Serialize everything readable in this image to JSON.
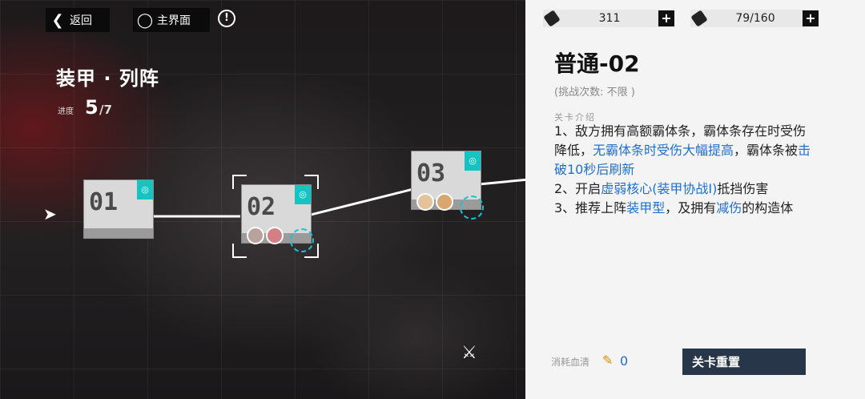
{
  "nav": {
    "back_label": "返回",
    "home_label": "主界面"
  },
  "chapter": {
    "title": "装甲 · 列阵",
    "progress_label": "进度",
    "progress_current": "5",
    "progress_total": "/7"
  },
  "stages": [
    {
      "number": "01"
    },
    {
      "number": "02"
    },
    {
      "number": "03"
    }
  ],
  "resources": [
    {
      "icon": "ticket-icon",
      "value": "311"
    },
    {
      "icon": "serum-icon",
      "value": "79/160"
    }
  ],
  "detail": {
    "title": "普通-02",
    "attempts": "(挑战次数: 不限 )",
    "desc_title": "关卡介绍",
    "line1_a": "1、敌方拥有高额霸体条，霸体条存在时受伤降低，",
    "line1_hl1": "无霸体条时受伤大幅提高",
    "line1_b": "，霸体条被",
    "line1_hl2": "击破10秒后刷新",
    "line2_a": "2、开启",
    "line2_hl": "虚弱核心(装甲协战I)",
    "line2_b": "抵挡伤害",
    "line3_a": "3、推荐上阵",
    "line3_hl1": "装甲型",
    "line3_b": "，及拥有",
    "line3_hl2": "减伤",
    "line3_c": "的构造体"
  },
  "cost": {
    "label": "消耗血清",
    "value": "0"
  },
  "reset_label": "关卡重置",
  "colors": {
    "accent_cyan": "#16c3c3",
    "highlight_blue": "#1f6fd1",
    "button_dark": "#273648"
  }
}
